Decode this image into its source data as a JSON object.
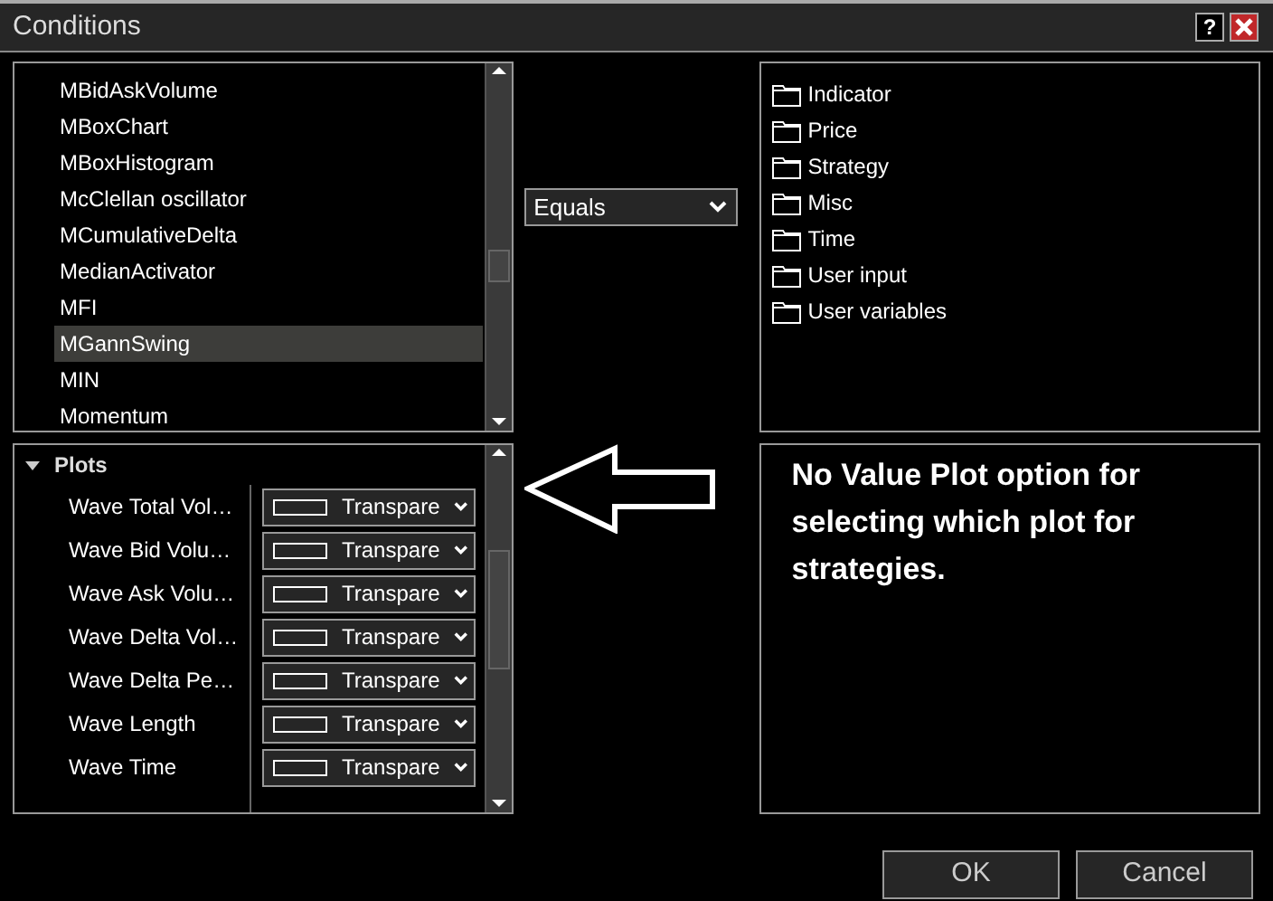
{
  "window": {
    "title": "Conditions",
    "help_button": "?"
  },
  "indicator_list": {
    "items": [
      {
        "label": "MBidAskVolume",
        "selected": false
      },
      {
        "label": "MBoxChart",
        "selected": false
      },
      {
        "label": "MBoxHistogram",
        "selected": false
      },
      {
        "label": "McClellan oscillator",
        "selected": false
      },
      {
        "label": "MCumulativeDelta",
        "selected": false
      },
      {
        "label": "MedianActivator",
        "selected": false
      },
      {
        "label": "MFI",
        "selected": false
      },
      {
        "label": "MGannSwing",
        "selected": true
      },
      {
        "label": "MIN",
        "selected": false
      },
      {
        "label": "Momentum",
        "selected": false
      }
    ]
  },
  "operator_dropdown": {
    "value": "Equals"
  },
  "category_tree": {
    "items": [
      {
        "label": "Indicator"
      },
      {
        "label": "Price"
      },
      {
        "label": "Strategy"
      },
      {
        "label": "Misc"
      },
      {
        "label": "Time"
      },
      {
        "label": "User input"
      },
      {
        "label": "User variables"
      }
    ]
  },
  "properties": {
    "section": "Plots",
    "expanded": true,
    "rows": [
      {
        "label": "Wave Total Vol…",
        "value": "Transpare"
      },
      {
        "label": "Wave Bid Volu…",
        "value": "Transpare"
      },
      {
        "label": "Wave Ask Volu…",
        "value": "Transpare"
      },
      {
        "label": "Wave Delta Vol…",
        "value": "Transpare"
      },
      {
        "label": "Wave Delta Pe…",
        "value": "Transpare"
      },
      {
        "label": "Wave Length",
        "value": "Transpare"
      },
      {
        "label": "Wave Time",
        "value": "Transpare"
      }
    ]
  },
  "note": "No Value Plot option for selecting which plot for strategies.",
  "buttons": [
    "OK",
    "Cancel"
  ]
}
